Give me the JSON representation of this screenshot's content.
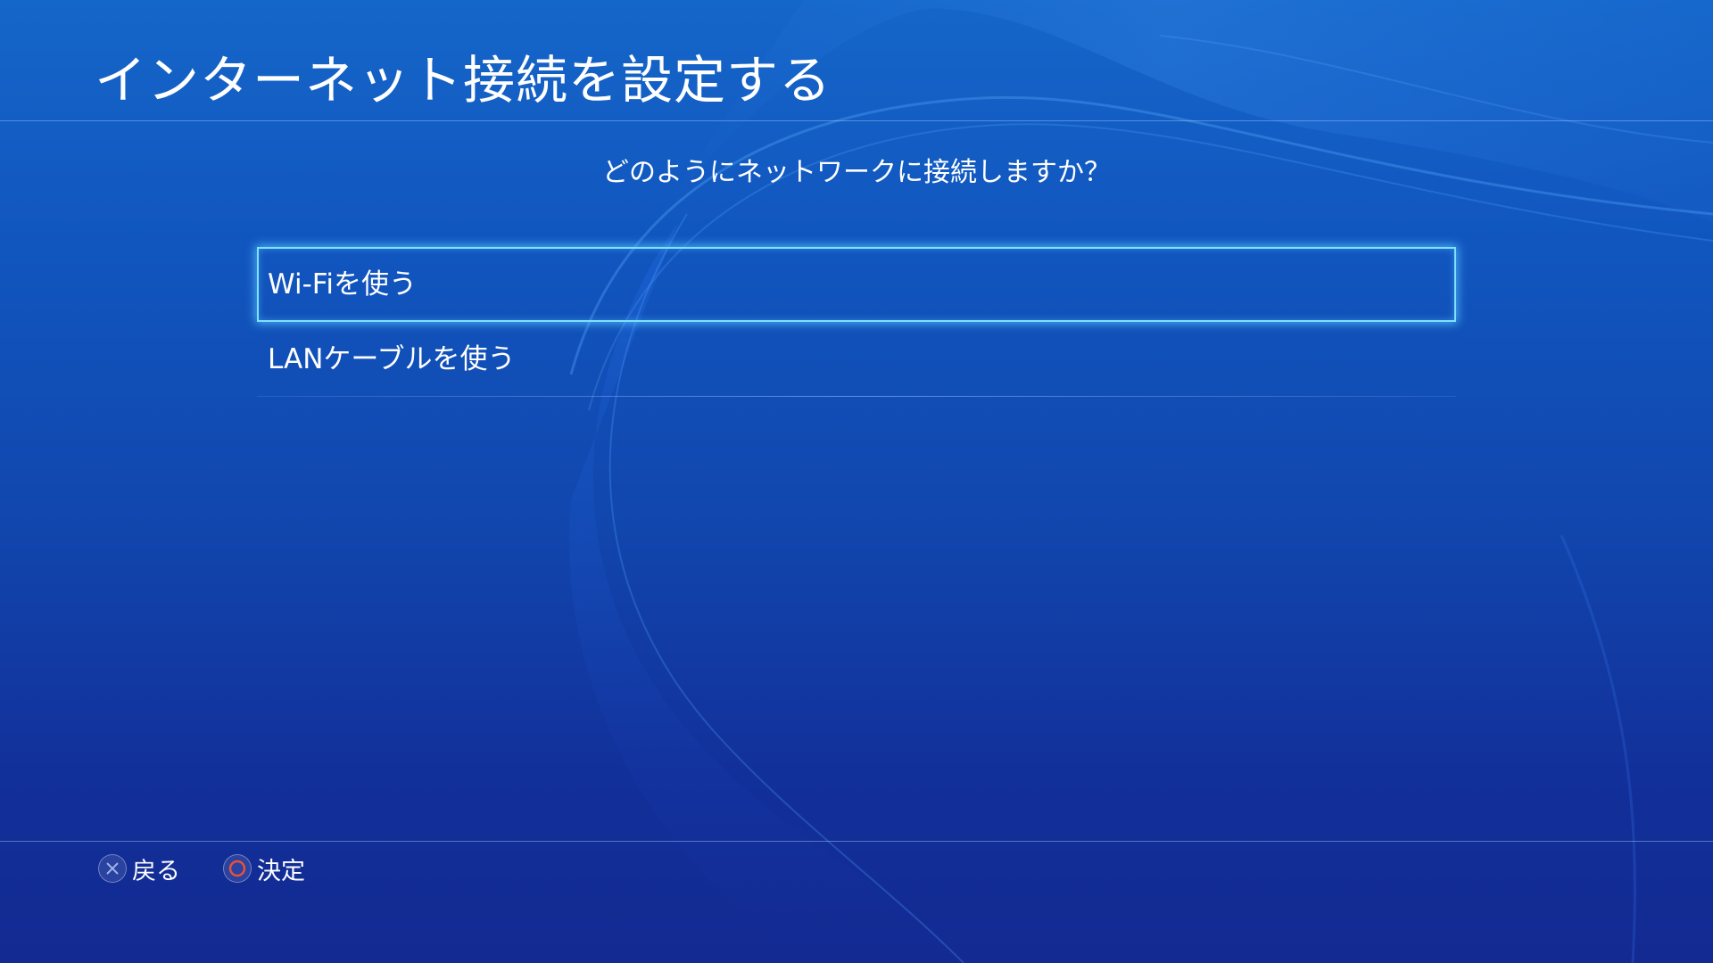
{
  "header": {
    "title": "インターネット接続を設定する"
  },
  "main": {
    "question": "どのようにネットワークに接続しますか？",
    "options": [
      {
        "label": "Wi-Fiを使う",
        "selected": true
      },
      {
        "label": "LANケーブルを使う",
        "selected": false
      }
    ]
  },
  "footer": {
    "hints": [
      {
        "icon": "cross-button-icon",
        "label": "戻る",
        "color": "#9fb4e8"
      },
      {
        "icon": "circle-button-icon",
        "label": "決定",
        "color": "#e8503c"
      }
    ]
  },
  "colors": {
    "background_top": "#1566c9",
    "background_bottom": "#132a92",
    "selection_glow": "#7ee0ff",
    "text": "#ffffff"
  }
}
